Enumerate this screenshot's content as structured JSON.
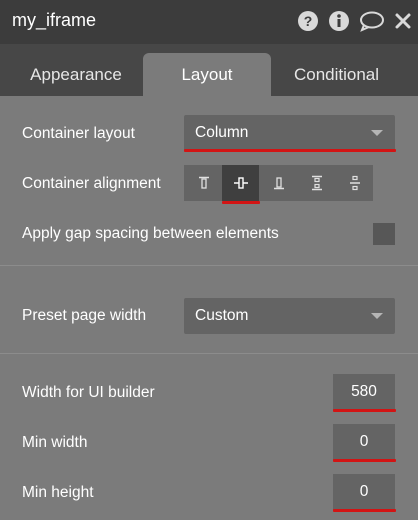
{
  "header": {
    "title": "my_iframe",
    "icons": [
      "help-icon",
      "info-icon",
      "comment-icon",
      "close-icon"
    ]
  },
  "tabs": [
    {
      "label": "Appearance",
      "active": false
    },
    {
      "label": "Layout",
      "active": true
    },
    {
      "label": "Conditional",
      "active": false
    }
  ],
  "container_layout": {
    "label": "Container layout",
    "value": "Column"
  },
  "container_alignment": {
    "label": "Container alignment",
    "options": [
      "align-top-icon",
      "align-center-icon",
      "align-bottom-icon",
      "space-between-icon",
      "space-around-icon"
    ],
    "selected": "align-center-icon"
  },
  "gap_spacing": {
    "label": "Apply gap spacing between elements",
    "checked": false
  },
  "preset_page_width": {
    "label": "Preset page width",
    "value": "Custom"
  },
  "width_ui_builder": {
    "label": "Width for UI builder",
    "value": "580"
  },
  "min_width": {
    "label": "Min width",
    "value": "0"
  },
  "min_height": {
    "label": "Min height",
    "value": "0"
  },
  "colors": {
    "header_bg": "#3c3c3c",
    "tabbar_bg": "#474747",
    "panel_bg": "#7b7b7b",
    "field_bg": "#646464",
    "highlight_red": "#d21414"
  }
}
